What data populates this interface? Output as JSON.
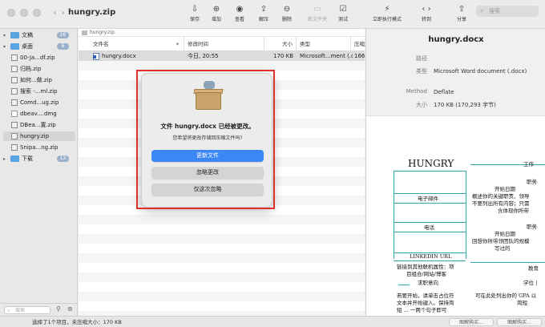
{
  "window": {
    "title": "hungry.zip"
  },
  "toolbar": {
    "buttons": [
      {
        "label": "保存",
        "icon": "save-icon",
        "enabled": true
      },
      {
        "label": "增加",
        "icon": "add-icon",
        "enabled": true
      },
      {
        "label": "查看",
        "icon": "view-icon",
        "enabled": true
      },
      {
        "label": "解压",
        "icon": "extract-icon",
        "enabled": true
      },
      {
        "label": "删除",
        "icon": "delete-icon",
        "enabled": true
      },
      {
        "label": "新文件夹",
        "icon": "new-folder-icon",
        "enabled": false
      },
      {
        "label": "测试",
        "icon": "test-icon",
        "enabled": true
      },
      {
        "label": "立即执行模式",
        "icon": "instant-mode-icon",
        "enabled": true
      },
      {
        "label": "转到",
        "icon": "goto-icon",
        "enabled": true
      },
      {
        "label": "分享",
        "icon": "share-icon",
        "enabled": true
      }
    ],
    "search_placeholder": "搜索"
  },
  "sidebar": {
    "items": [
      {
        "label": "文稿",
        "badge": "26",
        "type": "folder",
        "expanded": true
      },
      {
        "label": "桌面",
        "badge": "6",
        "type": "folder",
        "expanded": true
      },
      {
        "label": "00-Ja...df.zip",
        "badge": "",
        "type": "zip"
      },
      {
        "label": "归档.zip",
        "badge": "",
        "type": "zip"
      },
      {
        "label": "如何...做.zip",
        "badge": "",
        "type": "zip"
      },
      {
        "label": "搜索 -...ml.zip",
        "badge": "",
        "type": "zip"
      },
      {
        "label": "Comd...ug.zip",
        "badge": "",
        "type": "zip"
      },
      {
        "label": "dbeav....dmg",
        "badge": "",
        "type": "dmg"
      },
      {
        "label": "DBea...置.zip",
        "badge": "",
        "type": "zip"
      },
      {
        "label": "hungry.zip",
        "badge": "",
        "type": "zip",
        "selected": true
      },
      {
        "label": "Snipa...ng.zip",
        "badge": "",
        "type": "zip"
      },
      {
        "label": "下载",
        "badge": "12",
        "type": "folder",
        "expanded": false
      }
    ],
    "search_placeholder": "搜索"
  },
  "main": {
    "path": "hungry.zip",
    "columns": [
      "文件名",
      "修改时间",
      "大小",
      "类型",
      "压缩大"
    ],
    "files": [
      {
        "name": "hungry.docx",
        "modified": "今日, 20:55",
        "size": "170 KB",
        "type": "Microsoft...ment (.docx)",
        "compressed": "166"
      }
    ]
  },
  "dialog": {
    "title": "文件 hungry.docx 已经被更改。",
    "message": "您希望将更改存储回压缩文件吗?",
    "buttons": [
      "更新文件",
      "忽略更改",
      "仅这次忽略"
    ]
  },
  "preview": {
    "title": "hungry.docx",
    "fields": [
      {
        "key": "路径",
        "value": ""
      },
      {
        "key": "类型",
        "value": "Microsoft Word document (.docx)"
      },
      {
        "key": "Method",
        "value": "Deflate"
      },
      {
        "key": "大小",
        "value": "170 KB (170,293 字节)"
      }
    ],
    "doc": {
      "heading": "HUNGRY",
      "left_labels": [
        "电子邮件",
        "电话",
        "LINKEDIN URL"
      ],
      "left_texts": [
        "链接到其他联机属性：项",
        "目组合/网站/博客",
        "求职意向",
        "若要开始，请单击占位符",
        "文本并开始键入。保持简",
        "短 ... 一两个句子即可"
      ],
      "right_texts": [
        "工作",
        "职务",
        "开始日期",
        "概述你的关键职责、领导",
        "不要列出所有内容；只需",
        "含体现你所带",
        "职务",
        "开始日期",
        "回想你所带领团队的规模",
        "写过的",
        "教育",
        "学位 |",
        "可在此处列出你的 GPA 以",
        "简短"
      ]
    }
  },
  "status": {
    "text": "选择了1个项目，未压缩大小：170 KB",
    "buttons": [
      "图解购买...",
      "图解购买..."
    ]
  }
}
